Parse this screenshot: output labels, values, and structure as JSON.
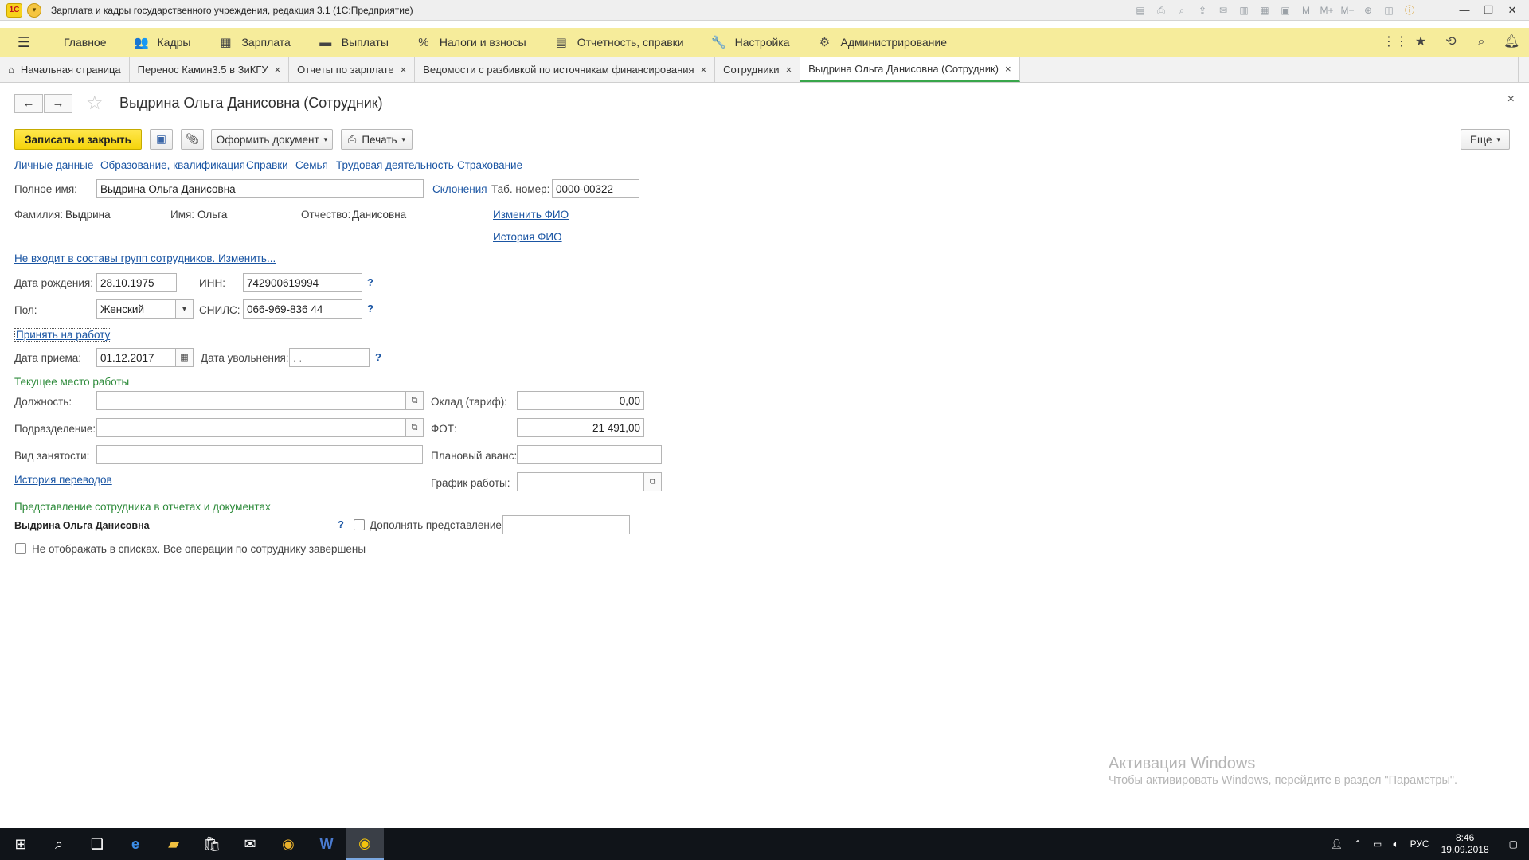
{
  "window": {
    "title": "Зарплата и кадры государственного учреждения, редакция 3.1  (1С:Предприятие)",
    "logo": "1С"
  },
  "sections": [
    {
      "icon": "burger-menu-icon",
      "label": "Главное"
    },
    {
      "icon": "people-icon",
      "label": "Кадры"
    },
    {
      "icon": "calculator-icon",
      "label": "Зарплата"
    },
    {
      "icon": "wallet-icon",
      "label": "Выплаты"
    },
    {
      "icon": "percent-icon",
      "label": "Налоги и взносы"
    },
    {
      "icon": "report-icon",
      "label": "Отчетность, справки"
    },
    {
      "icon": "wrench-icon",
      "label": "Настройка"
    },
    {
      "icon": "gear-icon",
      "label": "Администрирование"
    }
  ],
  "tabs": [
    {
      "label": "Начальная страница",
      "closable": false
    },
    {
      "label": "Перенос Камин3.5 в ЗиКГУ",
      "closable": true
    },
    {
      "label": "Отчеты по зарплате",
      "closable": true
    },
    {
      "label": "Ведомости с разбивкой по источникам финансирования",
      "closable": true
    },
    {
      "label": "Сотрудники",
      "closable": true
    },
    {
      "label": "Выдрина Ольга Данисовна (Сотрудник)",
      "closable": true,
      "active": true
    }
  ],
  "tab_close_glyph": "×",
  "form": {
    "title": "Выдрина Ольга Данисовна (Сотрудник)",
    "close_glyph": "×"
  },
  "toolbar": {
    "save_close": "Записать и закрыть",
    "make_doc": "Оформить документ",
    "print": "Печать",
    "more": "Еще"
  },
  "nav_links": [
    "Личные данные",
    "Образование, квалификация",
    "Справки",
    "Семья",
    "Трудовая деятельность",
    "Страхование"
  ],
  "personal": {
    "full_name_label": "Полное имя:",
    "full_name": "Выдрина Ольга Данисовна",
    "declensions": "Склонения",
    "tab_no_label": "Таб. номер:",
    "tab_no": "0000-00322",
    "surname_label": "Фамилия:",
    "surname": "Выдрина",
    "name_label": "Имя:",
    "name": "Ольга",
    "patronymic_label": "Отчество:",
    "patronymic": "Данисовна",
    "change_fio": "Изменить ФИО",
    "fio_history": "История ФИО",
    "groups_link": "Не входит в составы групп сотрудников. Изменить...",
    "birth_label": "Дата рождения:",
    "birth": "28.10.1975",
    "inn_label": "ИНН:",
    "inn": "742900619994",
    "gender_label": "Пол:",
    "gender": "Женский",
    "snils_label": "СНИЛС:",
    "snils": "066-969-836 44",
    "help": "?"
  },
  "employment": {
    "hire_link": "Принять на работу",
    "hire_date_label": "Дата приема:",
    "hire_date": "01.12.2017",
    "dismiss_label": "Дата увольнения:",
    "dismiss_date": " .  .",
    "current_place_title": "Текущее место работы",
    "position_label": "Должность:",
    "position": "",
    "salary_label": "Оклад (тариф):",
    "salary": "0,00",
    "department_label": "Подразделение:",
    "department": "",
    "fot_label": "ФОТ:",
    "fot": "21 491,00",
    "employment_type_label": "Вид занятости:",
    "employment_type": "",
    "advance_label": "Плановый аванс:",
    "advance": "",
    "transfers_history": "История переводов",
    "schedule_label": "График работы:",
    "schedule": ""
  },
  "representation": {
    "title": "Представление сотрудника в отчетах и документах",
    "value": "Выдрина Ольга Данисовна",
    "supplement_label": "Дополнять представление",
    "supplement_value": "",
    "hide_label": "Не отображать в списках. Все операции по сотруднику завершены"
  },
  "activation": {
    "title": "Активация Windows",
    "text": "Чтобы активировать Windows, перейдите в раздел \"Параметры\"."
  },
  "taskbar": {
    "lang": "РУС",
    "time": "8:46",
    "date": "19.09.2018"
  }
}
